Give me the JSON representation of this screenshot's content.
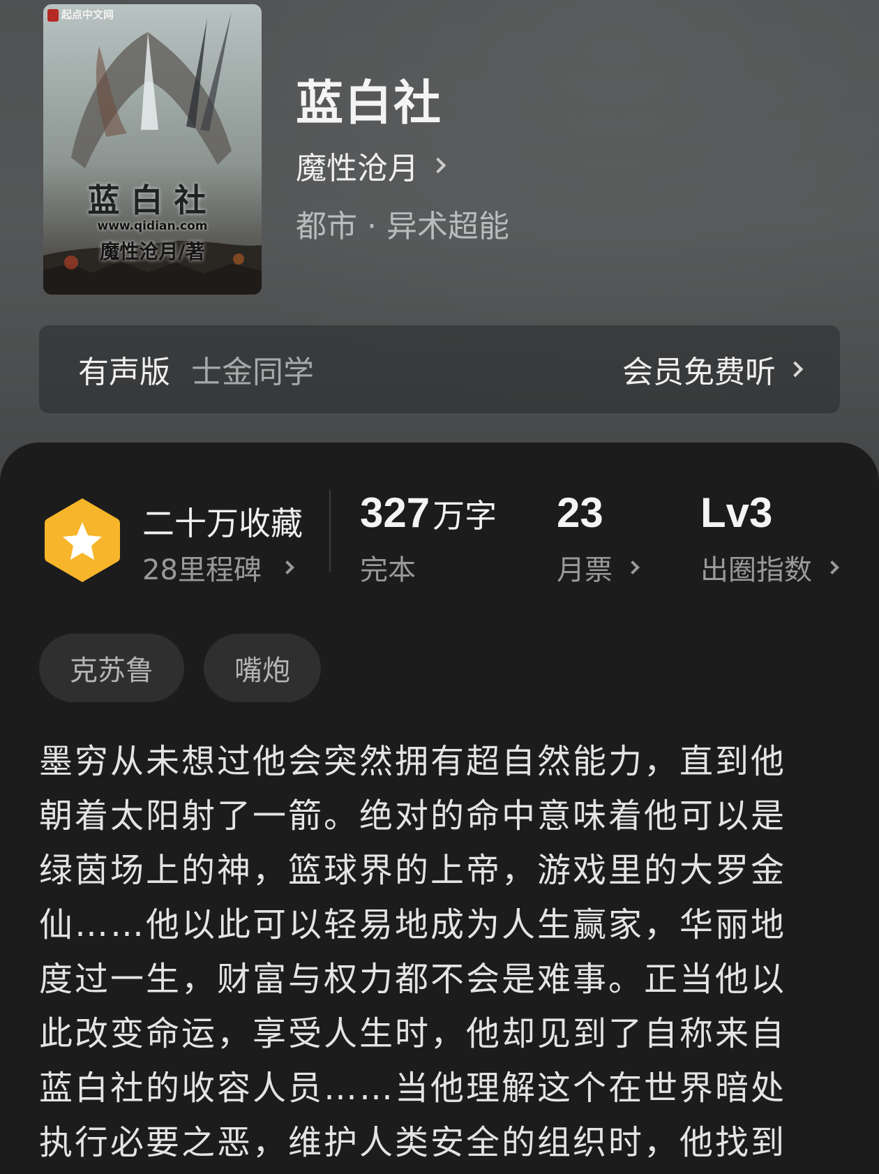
{
  "book": {
    "cover": {
      "publisher": "起点中文网",
      "title": "蓝白社",
      "url": "www.qidian.com",
      "author_line": "魔性沧月/著"
    },
    "title": "蓝白社",
    "author": "魔性沧月",
    "genre": "都市 · 异术超能"
  },
  "audio": {
    "label": "有声版",
    "narrator": "士金同学",
    "cta": "会员免费听"
  },
  "stats": {
    "favorites_title": "二十万收藏",
    "favorites_sub": "28里程碑",
    "word_count": "327",
    "word_unit": "万字",
    "status": "完本",
    "monthly_votes": "23",
    "monthly_votes_label": "月票",
    "level": "Lv3",
    "level_label": "出圈指数"
  },
  "tags": [
    "克苏鲁",
    "嘴炮"
  ],
  "synopsis": "墨穷从未想过他会突然拥有超自然能力，直到他朝着太阳射了一箭。绝对的命中意味着他可以是绿茵场上的神，篮球界的上帝，游戏里的大罗金仙……他以此可以轻易地成为人生赢家，华丽地度过一生，财富与权力都不会是难事。正当他以此改变命运，享受人生时，他却见到了自称来自蓝白社的收容人员……当他理解这个在世界暗处执行必要之恶，维护人类安全的组织时，他找到",
  "colors": {
    "background": "#1c1c1d",
    "header": "#505253",
    "badge": "#f6b52a",
    "tag_bg": "#2f2f30"
  }
}
